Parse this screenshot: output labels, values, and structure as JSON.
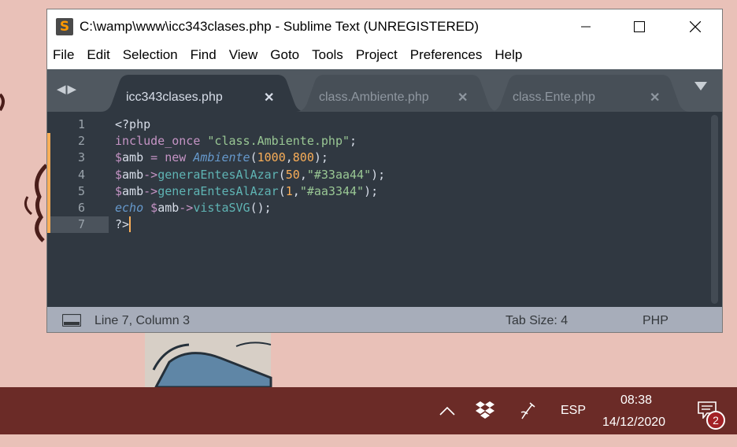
{
  "window": {
    "title": "C:\\wamp\\www\\icc343clases.php - Sublime Text (UNREGISTERED)",
    "app_icon_glyph": "S",
    "controls": [
      "minimize-icon",
      "maximize-icon",
      "close-icon"
    ]
  },
  "menu": [
    "File",
    "Edit",
    "Selection",
    "Find",
    "View",
    "Goto",
    "Tools",
    "Project",
    "Preferences",
    "Help"
  ],
  "tabs": [
    {
      "label": "icc343clases.php",
      "active": true
    },
    {
      "label": "class.Ambiente.php",
      "active": false
    },
    {
      "label": "class.Ente.php",
      "active": false
    }
  ],
  "tab_nav_glyph": "◀▶",
  "editor": {
    "line_numbers": [
      "1",
      "2",
      "3",
      "4",
      "5",
      "6",
      "7"
    ],
    "modified_lines": [
      2,
      3,
      4,
      5,
      6,
      7
    ],
    "current_line": 7,
    "lines": [
      [
        {
          "t": "<?php",
          "c": "plain"
        }
      ],
      [
        {
          "t": "include_once",
          "c": "keyword"
        },
        {
          "t": " ",
          "c": "plain"
        },
        {
          "t": "\"class.Ambiente.php\"",
          "c": "string"
        },
        {
          "t": ";",
          "c": "plain"
        }
      ],
      [
        {
          "t": "$",
          "c": "keyword"
        },
        {
          "t": "amb",
          "c": "plain"
        },
        {
          "t": " = ",
          "c": "keyword"
        },
        {
          "t": "new",
          "c": "keyword"
        },
        {
          "t": " ",
          "c": "plain"
        },
        {
          "t": "Ambiente",
          "c": "class"
        },
        {
          "t": "(",
          "c": "plain"
        },
        {
          "t": "1000",
          "c": "number"
        },
        {
          "t": ",",
          "c": "plain"
        },
        {
          "t": "800",
          "c": "number"
        },
        {
          "t": ");",
          "c": "plain"
        }
      ],
      [
        {
          "t": "$",
          "c": "keyword"
        },
        {
          "t": "amb",
          "c": "plain"
        },
        {
          "t": "->",
          "c": "keyword"
        },
        {
          "t": "generaEntesAlAzar",
          "c": "method"
        },
        {
          "t": "(",
          "c": "plain"
        },
        {
          "t": "50",
          "c": "number"
        },
        {
          "t": ",",
          "c": "plain"
        },
        {
          "t": "\"#33aa44\"",
          "c": "string"
        },
        {
          "t": ");",
          "c": "plain"
        }
      ],
      [
        {
          "t": "$",
          "c": "keyword"
        },
        {
          "t": "amb",
          "c": "plain"
        },
        {
          "t": "->",
          "c": "keyword"
        },
        {
          "t": "generaEntesAlAzar",
          "c": "method"
        },
        {
          "t": "(",
          "c": "plain"
        },
        {
          "t": "1",
          "c": "number"
        },
        {
          "t": ",",
          "c": "plain"
        },
        {
          "t": "\"#aa3344\"",
          "c": "string"
        },
        {
          "t": ");",
          "c": "plain"
        }
      ],
      [
        {
          "t": "echo",
          "c": "class"
        },
        {
          "t": " ",
          "c": "plain"
        },
        {
          "t": "$",
          "c": "keyword"
        },
        {
          "t": "amb",
          "c": "plain"
        },
        {
          "t": "->",
          "c": "keyword"
        },
        {
          "t": "vistaSVG",
          "c": "method"
        },
        {
          "t": "();",
          "c": "plain"
        }
      ],
      [
        {
          "t": "?>",
          "c": "plain"
        }
      ]
    ]
  },
  "status": {
    "position": "Line 7, Column 3",
    "tab_size": "Tab Size: 4",
    "syntax": "PHP"
  },
  "taskbar": {
    "language": "ESP",
    "time": "08:38",
    "date": "14/12/2020",
    "notification_count": "2",
    "tray_icons": [
      "chevron-up-icon",
      "dropbox-icon",
      "pen-icon",
      "notifications-icon"
    ]
  },
  "colors": {
    "editor_bg": "#303841",
    "tab_bar_bg": "#505860",
    "active_tab_bg": "#303841",
    "inactive_tab_bg": "#474f57",
    "status_bg": "#a7adba",
    "taskbar_bg": "#6b2b27",
    "desktop_bg": "#e9c1b8",
    "plain": "#d8dee9",
    "keyword": "#c594c5",
    "string": "#99c794",
    "number": "#f9ae58",
    "class": "#6699cc",
    "method": "#5fb4b4",
    "modified_marker": "#f9ae58"
  }
}
